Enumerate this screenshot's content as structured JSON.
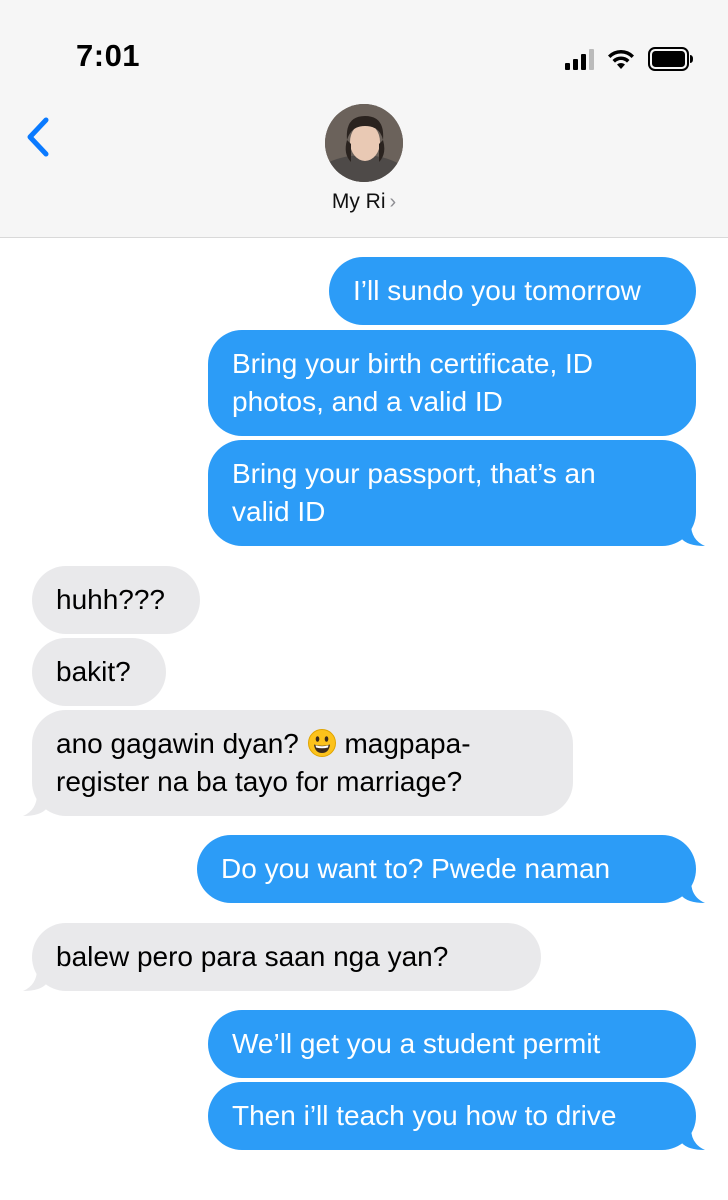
{
  "status": {
    "time": "7:01"
  },
  "contact": {
    "name": "My Ri",
    "chevron": "›"
  },
  "colors": {
    "outgoing": "#2c9cf7",
    "incoming": "#e9e9eb",
    "accent": "#0a7aff"
  },
  "messages": [
    {
      "dir": "out",
      "text": "I’ll sundo you tomorrow"
    },
    {
      "dir": "out",
      "line1": "Bring your birth certificate, ID",
      "line2": "photos, and a valid ID"
    },
    {
      "dir": "out",
      "line1": "Bring your passport, that’s an",
      "line2": "valid ID"
    },
    {
      "dir": "in",
      "text": "huhh???"
    },
    {
      "dir": "in",
      "text": "bakit?"
    },
    {
      "dir": "in",
      "line1a": "ano gagawin dyan?",
      "emoji": "grinning-face-emoji",
      "line1b": "magpapa-",
      "line2": "register na ba tayo for marriage?"
    },
    {
      "dir": "out",
      "text": "Do you want to? Pwede naman"
    },
    {
      "dir": "in",
      "text": "balew  pero para saan nga yan?"
    },
    {
      "dir": "out",
      "text": "We’ll get you a student permit"
    },
    {
      "dir": "out",
      "text": "Then i’ll teach you how to drive"
    }
  ]
}
